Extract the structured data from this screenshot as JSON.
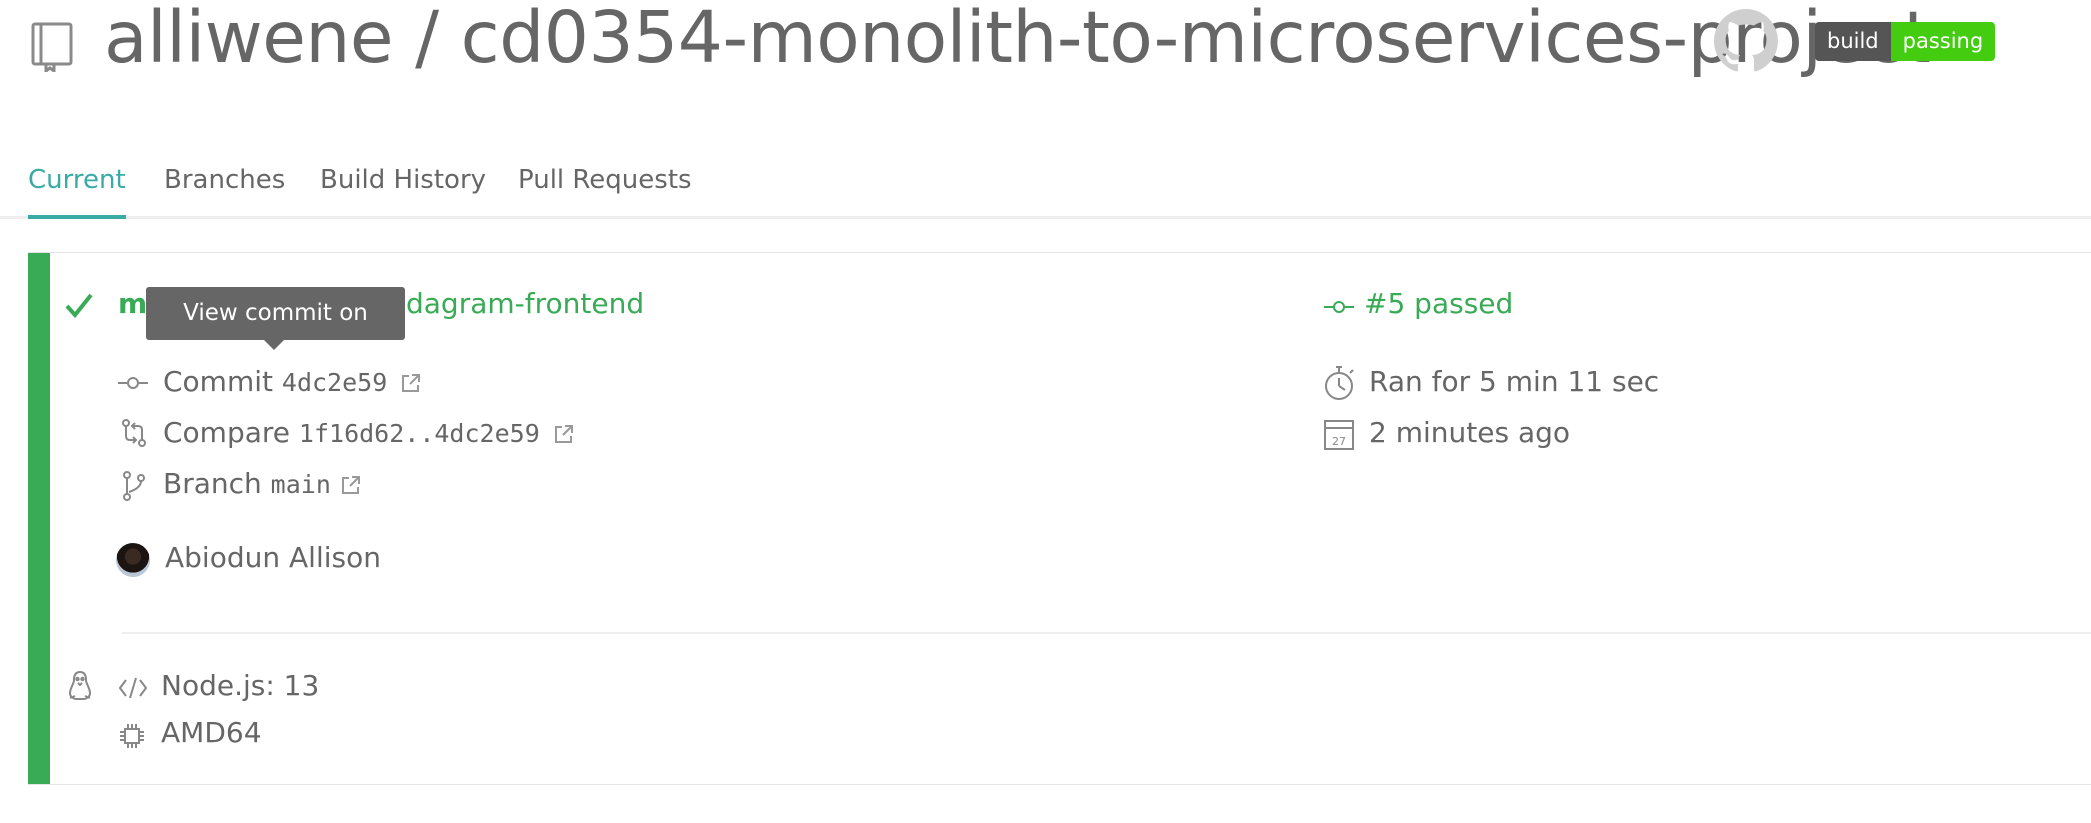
{
  "header": {
    "repo_title": "alliwene / cd0354-monolith-to-microservices-project",
    "badge_left": "build",
    "badge_right": "passing"
  },
  "tabs": [
    "Current",
    "Branches",
    "Build History",
    "Pull Requests"
  ],
  "build": {
    "branch_title_prefix": "m",
    "branch_title_suffix": "dagram-frontend",
    "tooltip": "View commit on GitHub",
    "commit_label": "Commit",
    "commit_sha": "4dc2e59",
    "compare_label": "Compare",
    "compare_range": "1f16d62..4dc2e59",
    "branch_label": "Branch",
    "branch_name": "main",
    "author": "Abiodun Allison",
    "status": "#5 passed",
    "duration": "Ran for 5 min 11 sec",
    "finished": "2 minutes ago",
    "calendar_day": "27",
    "language": "Node.js: 13",
    "arch": "AMD64"
  },
  "colors": {
    "accent": "#39aaa4",
    "passed": "#39aa56",
    "badge_dark": "#555555",
    "badge_green": "#44cc11",
    "text": "#666666"
  }
}
